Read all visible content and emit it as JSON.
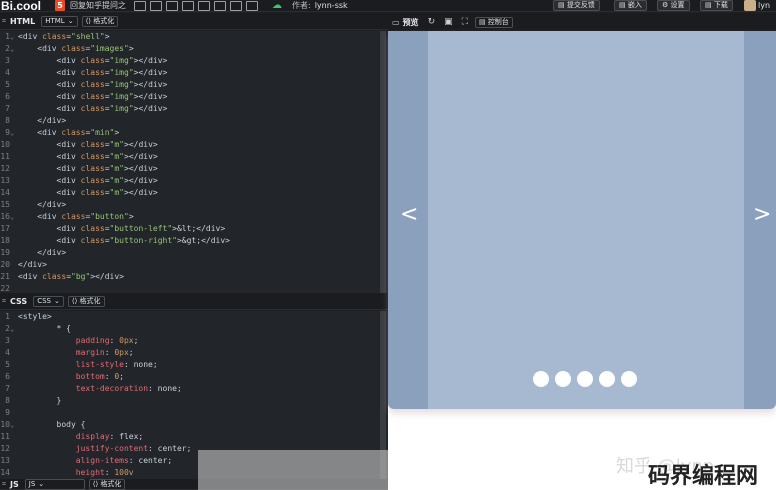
{
  "topbar": {
    "logo": "Bi.cool",
    "html5_badge": "5",
    "project_title": "回复知乎提问之",
    "author_label": "作者:",
    "author_name": "lynn-ssk",
    "feedback_button": "提交反馈",
    "embed_button": "嵌入",
    "settings_button": "设置",
    "download_button": "下载",
    "user_name": "lyn"
  },
  "html_panel": {
    "lang": "HTML",
    "select_value": "HTML",
    "format_label": "格式化",
    "lines": [
      {
        "n": "1",
        "fold": "⌄",
        "text": "<div class=\"shell\">"
      },
      {
        "n": "2",
        "fold": "⌄",
        "text": "    <div class=\"images\">"
      },
      {
        "n": "3",
        "fold": "",
        "text": "        <div class=\"img\"></div>"
      },
      {
        "n": "4",
        "fold": "",
        "text": "        <div class=\"img\"></div>"
      },
      {
        "n": "5",
        "fold": "",
        "text": "        <div class=\"img\"></div>"
      },
      {
        "n": "6",
        "fold": "",
        "text": "        <div class=\"img\"></div>"
      },
      {
        "n": "7",
        "fold": "",
        "text": "        <div class=\"img\"></div>"
      },
      {
        "n": "8",
        "fold": "",
        "text": "    </div>"
      },
      {
        "n": "9",
        "fold": "⌄",
        "text": "    <div class=\"min\">"
      },
      {
        "n": "10",
        "fold": "",
        "text": "        <div class=\"m\"></div>"
      },
      {
        "n": "11",
        "fold": "",
        "text": "        <div class=\"m\"></div>"
      },
      {
        "n": "12",
        "fold": "",
        "text": "        <div class=\"m\"></div>"
      },
      {
        "n": "13",
        "fold": "",
        "text": "        <div class=\"m\"></div>"
      },
      {
        "n": "14",
        "fold": "",
        "text": "        <div class=\"m\"></div>"
      },
      {
        "n": "15",
        "fold": "",
        "text": "    </div>"
      },
      {
        "n": "16",
        "fold": "⌄",
        "text": "    <div class=\"button\">"
      },
      {
        "n": "17",
        "fold": "",
        "text": "        <div class=\"button-left\">&lt;</div>"
      },
      {
        "n": "18",
        "fold": "",
        "text": "        <div class=\"button-right\">&gt;</div>"
      },
      {
        "n": "19",
        "fold": "",
        "text": "    </div>"
      },
      {
        "n": "20",
        "fold": "",
        "text": "</div>"
      },
      {
        "n": "21",
        "fold": "",
        "text": "<div class=\"bg\"></div>"
      },
      {
        "n": "22",
        "fold": "",
        "text": ""
      }
    ]
  },
  "css_panel": {
    "lang": "CSS",
    "select_value": "CSS",
    "format_label": "格式化",
    "lines": [
      {
        "n": "1",
        "fold": "",
        "text": "<style>"
      },
      {
        "n": "2",
        "fold": "⌄",
        "text": "        * {"
      },
      {
        "n": "3",
        "fold": "",
        "text": "            padding: 0px;"
      },
      {
        "n": "4",
        "fold": "",
        "text": "            margin: 0px;"
      },
      {
        "n": "5",
        "fold": "",
        "text": "            list-style: none;"
      },
      {
        "n": "6",
        "fold": "",
        "text": "            bottom: 0;"
      },
      {
        "n": "7",
        "fold": "",
        "text": "            text-decoration: none;"
      },
      {
        "n": "8",
        "fold": "",
        "text": "        }"
      },
      {
        "n": "9",
        "fold": "",
        "text": ""
      },
      {
        "n": "10",
        "fold": "⌄",
        "text": "        body {"
      },
      {
        "n": "11",
        "fold": "",
        "text": "            display: flex;"
      },
      {
        "n": "12",
        "fold": "",
        "text": "            justify-content: center;"
      },
      {
        "n": "13",
        "fold": "",
        "text": "            align-items: center;"
      },
      {
        "n": "14",
        "fold": "",
        "text": "            height: 100v"
      }
    ]
  },
  "js_panel": {
    "lang": "JS",
    "select_value": "JS",
    "format_label": "格式化"
  },
  "preview_panel": {
    "label": "预览",
    "console_label": "控制台",
    "left_arrow": "<",
    "right_arrow": ">"
  },
  "watermark": {
    "zhihu": "知乎 @lynn",
    "site": "码界编程网"
  },
  "colors": {
    "editor_bg": "#22252a",
    "shell_bg": "#8ba0bd",
    "slide_bg": "#a7b9d0",
    "dot": "#ffffff"
  }
}
